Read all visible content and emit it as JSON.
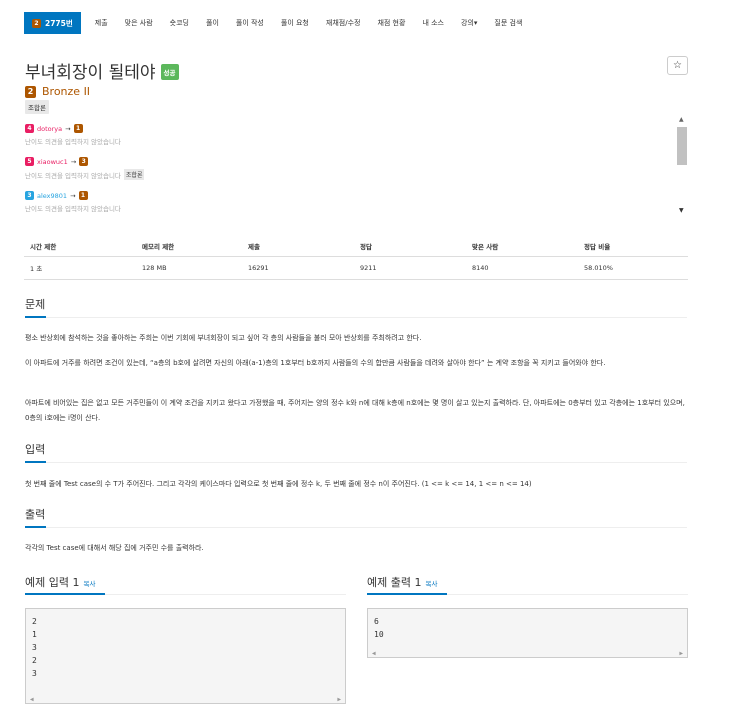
{
  "nav": {
    "active_tier_number": "2",
    "active_label": "2775번",
    "items": [
      "제출",
      "맞은 사람",
      "숏코딩",
      "풀이",
      "풀이 작성",
      "풀이 요청",
      "재채점/수정",
      "채점 현황",
      "내 소스",
      "강의▾",
      "질문 검색"
    ]
  },
  "problem": {
    "title": "부녀회장이 될테야",
    "status_badge": "성공",
    "star_icon": "star-icon",
    "tier_icon_number": "2",
    "tier_name": "Bronze II",
    "tag": "조합론"
  },
  "opinions": [
    {
      "tier_icon": "4",
      "tier_color": "#e91e63",
      "user": "dotorya",
      "arrow": "→",
      "voted_tier": "1",
      "voted_color": "#ad5600",
      "text": "난이도 의견을 입력하지 않았습니다",
      "tag": ""
    },
    {
      "tier_icon": "5",
      "tier_color": "#e91e63",
      "user": "xiaowuc1",
      "arrow": "→",
      "voted_tier": "3",
      "voted_color": "#ad5600",
      "text": "난이도 의견을 입력하지 않았습니다",
      "tag": "조합론"
    },
    {
      "tier_icon": "3",
      "tier_color": "#27a4e0",
      "user": "alex9801",
      "arrow": "→",
      "voted_tier": "1",
      "voted_color": "#ad5600",
      "text": "난이도 의견을 입력하지 않았습니다",
      "tag": ""
    }
  ],
  "stats": {
    "headers": [
      "시간 제한",
      "메모리 제한",
      "제출",
      "정답",
      "맞은 사람",
      "정답 비율"
    ],
    "values": [
      "1 초",
      "128 MB",
      "16291",
      "9211",
      "8140",
      "58.010%"
    ]
  },
  "sections": {
    "problem_heading": "문제",
    "problem_p1": "평소 반상회에 참석하는 것을 좋아하는 주희는 이번 기회에 부녀회장이 되고 싶어 각 층의 사람들을 불러 모아 반상회를 주최하려고 한다.",
    "problem_p2": "이 아파트에 거주를 하려면 조건이 있는데, “a층의 b호에 살려면 자신의 아래(a-1)층의 1호부터 b호까지 사람들의 수의 합만큼 사람들을 데려와 살아야 한다” 는 계약 조항을 꼭 지키고 들어와야 한다.",
    "problem_p3": "아파트에 비어있는 집은 없고 모든 거주민들이 이 계약 조건을 지키고 왔다고 가정했을 때, 주어지는 양의 정수 k와 n에 대해 k층에 n호에는 몇 명이 살고 있는지 출력하라. 단, 아파트에는 0층부터 있고 각층에는 1호부터 있으며, 0층의 i호에는 i명이 산다.",
    "input_heading": "입력",
    "input_p": "첫 번째 줄에 Test case의 수 T가 주어진다. 그리고 각각의 케이스마다 입력으로 첫 번째 줄에 정수 k, 두 번째 줄에 정수 n이 주어진다. (1 <= k <= 14, 1 <= n <= 14)",
    "output_heading": "출력",
    "output_p": "각각의 Test case에 대해서 해당 집에 거주민 수를 출력하라."
  },
  "examples": {
    "input_title": "예제 입력 1",
    "output_title": "예제 출력 1",
    "copy_label": "복사",
    "input_lines": [
      "2",
      "1",
      "3",
      "2",
      "3"
    ],
    "output_lines": [
      "6",
      "10"
    ]
  }
}
